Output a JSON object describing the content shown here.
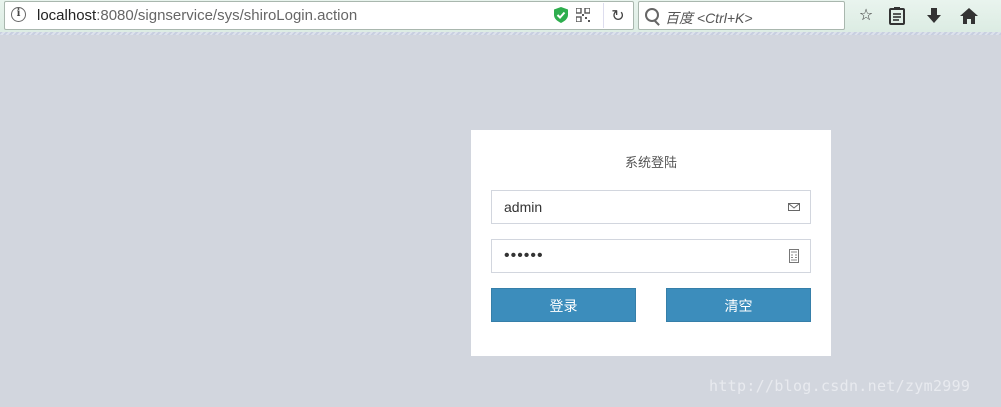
{
  "browser": {
    "url_host": "localhost",
    "url_rest": ":8080/signservice/sys/shiroLogin.action",
    "search_placeholder": "百度 <Ctrl+K>",
    "reload_icon": "reload-icon",
    "toolbar_icons": [
      "star-icon",
      "reading-list-icon",
      "download-icon",
      "home-icon"
    ]
  },
  "login": {
    "title": "系统登陆",
    "username_value": "admin",
    "password_value": "123456",
    "login_button": "登录",
    "clear_button": "清空",
    "accent_color": "#3c8dbc"
  },
  "watermark": "http://blog.csdn.net/zym2999"
}
